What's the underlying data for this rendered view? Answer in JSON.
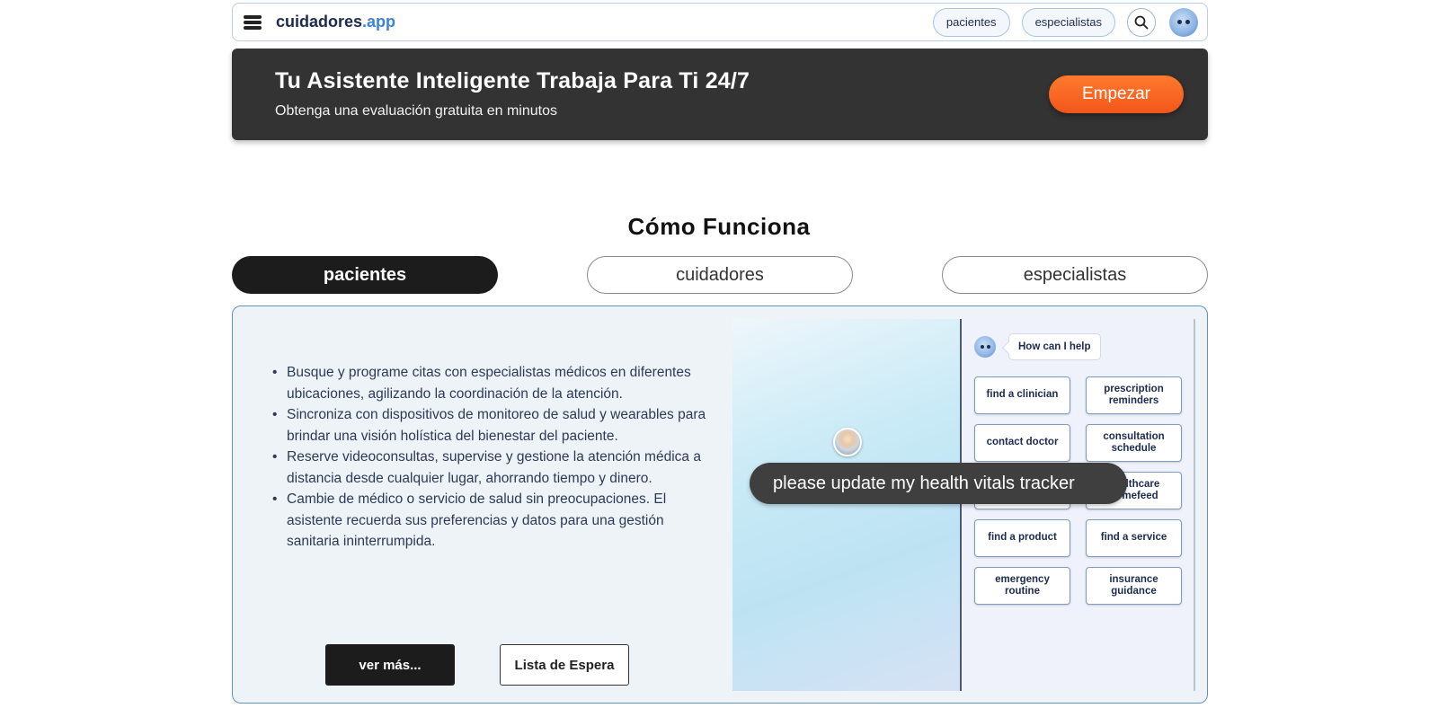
{
  "header": {
    "logo_main": "cuidadores",
    "logo_tld": ".app",
    "nav": [
      "pacientes",
      "especialistas"
    ]
  },
  "banner": {
    "title": "Tu Asistente Inteligente Trabaja Para Ti 24/7",
    "subtitle": "Obtenga una evaluación gratuita en minutos",
    "cta": "Empezar"
  },
  "section": {
    "title": "Cómo Funciona",
    "tabs": [
      "pacientes",
      "cuidadores",
      "especialistas"
    ],
    "active_tab": "pacientes"
  },
  "content": {
    "features": [
      "Busque y programe citas con especialistas médicos en diferentes ubicaciones, agilizando la coordinación de la atención.",
      "Sincroniza con dispositivos de monitoreo de salud y wearables para brindar una visión holística del bienestar del paciente.",
      "Reserve videoconsultas, supervise y gestione la atención médica a distancia desde cualquier lugar, ahorrando tiempo y dinero.",
      "Cambie de médico o servicio de salud sin preocupaciones. El asistente recuerda sus preferencias y datos para una gestión sanitaria ininterrumpida."
    ],
    "more_button": "ver más...",
    "waitlist_button": "Lista de Espera"
  },
  "demo": {
    "help_text": "How can I help",
    "chips": [
      "find a clinician",
      "prescription reminders",
      "contact doctor",
      "consultation schedule",
      "healthcare homefeed",
      "find a product",
      "find a service",
      "emergency routine",
      "insurance guidance"
    ],
    "chip_left_col": [
      "find a clinician",
      "contact doctor",
      "find a product",
      "emergency routine"
    ],
    "chip_right_col": [
      "prescription reminders",
      "consultation schedule",
      "lthcare\nomefeed",
      "find a service",
      "insurance guidance"
    ],
    "chat_message": "please update my health vitals tracker"
  },
  "colors": {
    "accent_orange": "#f2561a",
    "brand_blue": "#3a86d4",
    "dark": "#1c1c1c"
  }
}
